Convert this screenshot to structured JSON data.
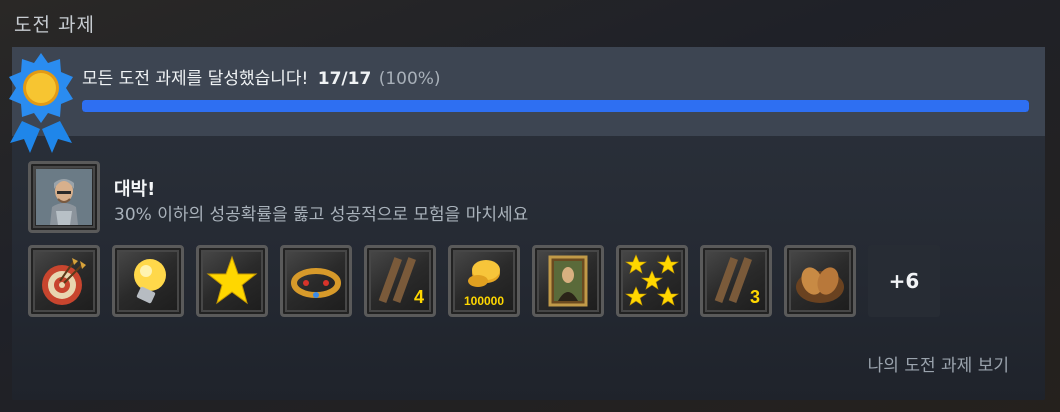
{
  "section": {
    "title": "도전 과제"
  },
  "progress": {
    "message": "모든 도전 과제를 달성했습니다!",
    "count": "17/17",
    "percent_text": "(100%)",
    "fraction": 1.0
  },
  "featured": {
    "icon": "knight-icon",
    "name": "대박!",
    "description": "30% 이하의 성공확률을 뚫고 성공적으로 모험을 마치세요"
  },
  "achievements": [
    {
      "icon": "target-arrows-icon"
    },
    {
      "icon": "lightbulb-icon"
    },
    {
      "icon": "star-icon"
    },
    {
      "icon": "crown-icon"
    },
    {
      "icon": "ladder-4-icon",
      "label": "4"
    },
    {
      "icon": "coins-icon",
      "label": "100000"
    },
    {
      "icon": "mona-lisa-icon"
    },
    {
      "icon": "five-stars-icon"
    },
    {
      "icon": "ladder-3-icon",
      "label": "3"
    },
    {
      "icon": "bread-basket-icon"
    }
  ],
  "more": {
    "label": "+6"
  },
  "footer": {
    "view_link": "나의 도전 과제 보기"
  },
  "colors": {
    "accent": "#2e6ff2",
    "badge": "#2a8cf0",
    "gold": "#f5c518"
  }
}
